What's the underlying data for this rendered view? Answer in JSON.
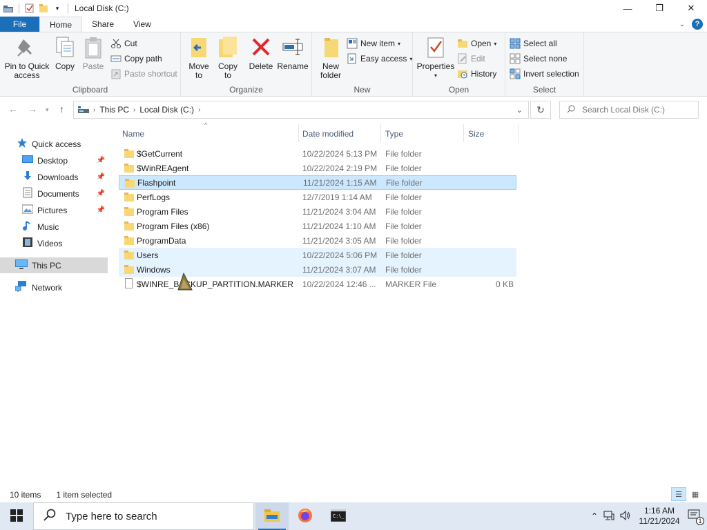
{
  "window": {
    "title": "Local Disk (C:)",
    "minimize": "—",
    "maximize": "❐",
    "close": "✕"
  },
  "ribbon_tabs": [
    "File",
    "Home",
    "Share",
    "View"
  ],
  "ribbon": {
    "clipboard": {
      "label": "Clipboard",
      "pin": "Pin to Quick\naccess",
      "copy": "Copy",
      "paste": "Paste",
      "cut": "Cut",
      "copy_path": "Copy path",
      "paste_shortcut": "Paste shortcut"
    },
    "organize": {
      "label": "Organize",
      "move_to": "Move\nto",
      "copy_to": "Copy\nto",
      "delete": "Delete",
      "rename": "Rename"
    },
    "new": {
      "label": "New",
      "new_folder": "New\nfolder",
      "new_item": "New item",
      "easy_access": "Easy access"
    },
    "open": {
      "label": "Open",
      "properties": "Properties",
      "open": "Open",
      "edit": "Edit",
      "history": "History"
    },
    "select": {
      "label": "Select",
      "select_all": "Select all",
      "select_none": "Select none",
      "invert": "Invert selection"
    }
  },
  "address": {
    "crumbs": [
      "This PC",
      "Local Disk (C:)"
    ],
    "search_placeholder": "Search Local Disk (C:)"
  },
  "sidebar": {
    "items": [
      {
        "label": "Quick access",
        "icon": "star-icon",
        "pinned": false
      },
      {
        "label": "Desktop",
        "icon": "desktop-icon",
        "pinned": true
      },
      {
        "label": "Downloads",
        "icon": "download-icon",
        "pinned": true
      },
      {
        "label": "Documents",
        "icon": "documents-icon",
        "pinned": true
      },
      {
        "label": "Pictures",
        "icon": "pictures-icon",
        "pinned": true
      },
      {
        "label": "Music",
        "icon": "music-icon",
        "pinned": false
      },
      {
        "label": "Videos",
        "icon": "videos-icon",
        "pinned": false
      },
      {
        "label": "This PC",
        "icon": "pc-icon",
        "pinned": false
      },
      {
        "label": "Network",
        "icon": "network-icon",
        "pinned": false
      }
    ]
  },
  "columns": {
    "name": "Name",
    "date": "Date modified",
    "type": "Type",
    "size": "Size"
  },
  "files": [
    {
      "name": "$GetCurrent",
      "date": "10/22/2024 5:13 PM",
      "type": "File folder",
      "size": "",
      "kind": "folder",
      "state": "normal"
    },
    {
      "name": "$WinREAgent",
      "date": "10/22/2024 2:19 PM",
      "type": "File folder",
      "size": "",
      "kind": "folder",
      "state": "normal"
    },
    {
      "name": "Flashpoint",
      "date": "11/21/2024 1:15 AM",
      "type": "File folder",
      "size": "",
      "kind": "folder",
      "state": "selected"
    },
    {
      "name": "PerfLogs",
      "date": "12/7/2019 1:14 AM",
      "type": "File folder",
      "size": "",
      "kind": "folder",
      "state": "normal"
    },
    {
      "name": "Program Files",
      "date": "11/21/2024 3:04 AM",
      "type": "File folder",
      "size": "",
      "kind": "folder",
      "state": "normal"
    },
    {
      "name": "Program Files (x86)",
      "date": "11/21/2024 1:10 AM",
      "type": "File folder",
      "size": "",
      "kind": "folder",
      "state": "normal"
    },
    {
      "name": "ProgramData",
      "date": "11/21/2024 3:05 AM",
      "type": "File folder",
      "size": "",
      "kind": "folder",
      "state": "normal"
    },
    {
      "name": "Users",
      "date": "10/22/2024 5:06 PM",
      "type": "File folder",
      "size": "",
      "kind": "folder",
      "state": "hover"
    },
    {
      "name": "Windows",
      "date": "11/21/2024 3:07 AM",
      "type": "File folder",
      "size": "",
      "kind": "folder",
      "state": "hover"
    },
    {
      "name": "$WINRE_BACKUP_PARTITION.MARKER",
      "date": "10/22/2024 12:46 ...",
      "type": "MARKER File",
      "size": "0 KB",
      "kind": "file",
      "state": "normal"
    }
  ],
  "status": {
    "count": "10 items",
    "selected": "1 item selected"
  },
  "taskbar": {
    "search_placeholder": "Type here to search",
    "time": "1:16 AM",
    "date": "11/21/2024",
    "notifications": "1"
  },
  "colors": {
    "file_tab": "#1a6fb8",
    "selection": "#cce8ff",
    "hover": "#e5f3ff",
    "folder": "#f8d775"
  }
}
